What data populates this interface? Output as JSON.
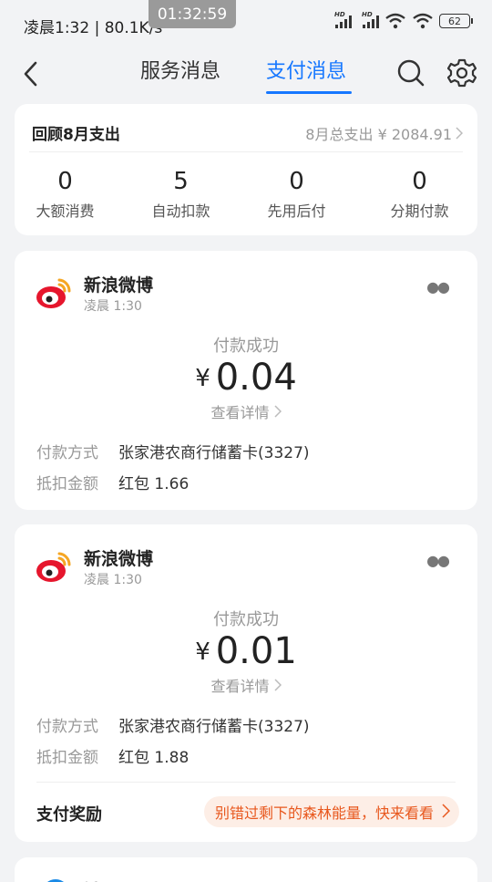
{
  "status_bar": {
    "left_text": "凌晨1:32 | 80.1K/s",
    "clock": "01:32:59",
    "battery": "62"
  },
  "nav": {
    "tabs": [
      {
        "label": "服务消息",
        "active": false
      },
      {
        "label": "支付消息",
        "active": true
      }
    ],
    "accent": "#1677ff",
    "icons": [
      "back-arrow-icon",
      "search-icon",
      "gear-icon"
    ]
  },
  "summary": {
    "title": "回顾8月支出",
    "total": "8月总支出 ¥ 2084.91",
    "stats": [
      {
        "value": "0",
        "label": "大额消费"
      },
      {
        "value": "5",
        "label": "自动扣款"
      },
      {
        "value": "0",
        "label": "先用后付"
      },
      {
        "value": "0",
        "label": "分期付款"
      }
    ]
  },
  "payments": [
    {
      "merchant": "新浪微博",
      "time": "凌晨 1:30",
      "status": "付款成功",
      "currency": "¥",
      "amount": "0.04",
      "detail_link": "查看详情",
      "method_label": "付款方式",
      "method_value": "张家港农商行储蓄卡(3327)",
      "deduct_label": "抵扣金额",
      "deduct_value": "红包 1.66"
    },
    {
      "merchant": "新浪微博",
      "time": "凌晨 1:30",
      "status": "付款成功",
      "currency": "¥",
      "amount": "0.01",
      "detail_link": "查看详情",
      "method_label": "付款方式",
      "method_value": "张家港农商行储蓄卡(3327)",
      "deduct_label": "抵扣金额",
      "deduct_value": "红包 1.88",
      "reward_label": "支付奖励",
      "reward_text": "别错过剩下的森林能量，快来看看"
    }
  ],
  "partial_card": {
    "merchant": "饿了"
  }
}
